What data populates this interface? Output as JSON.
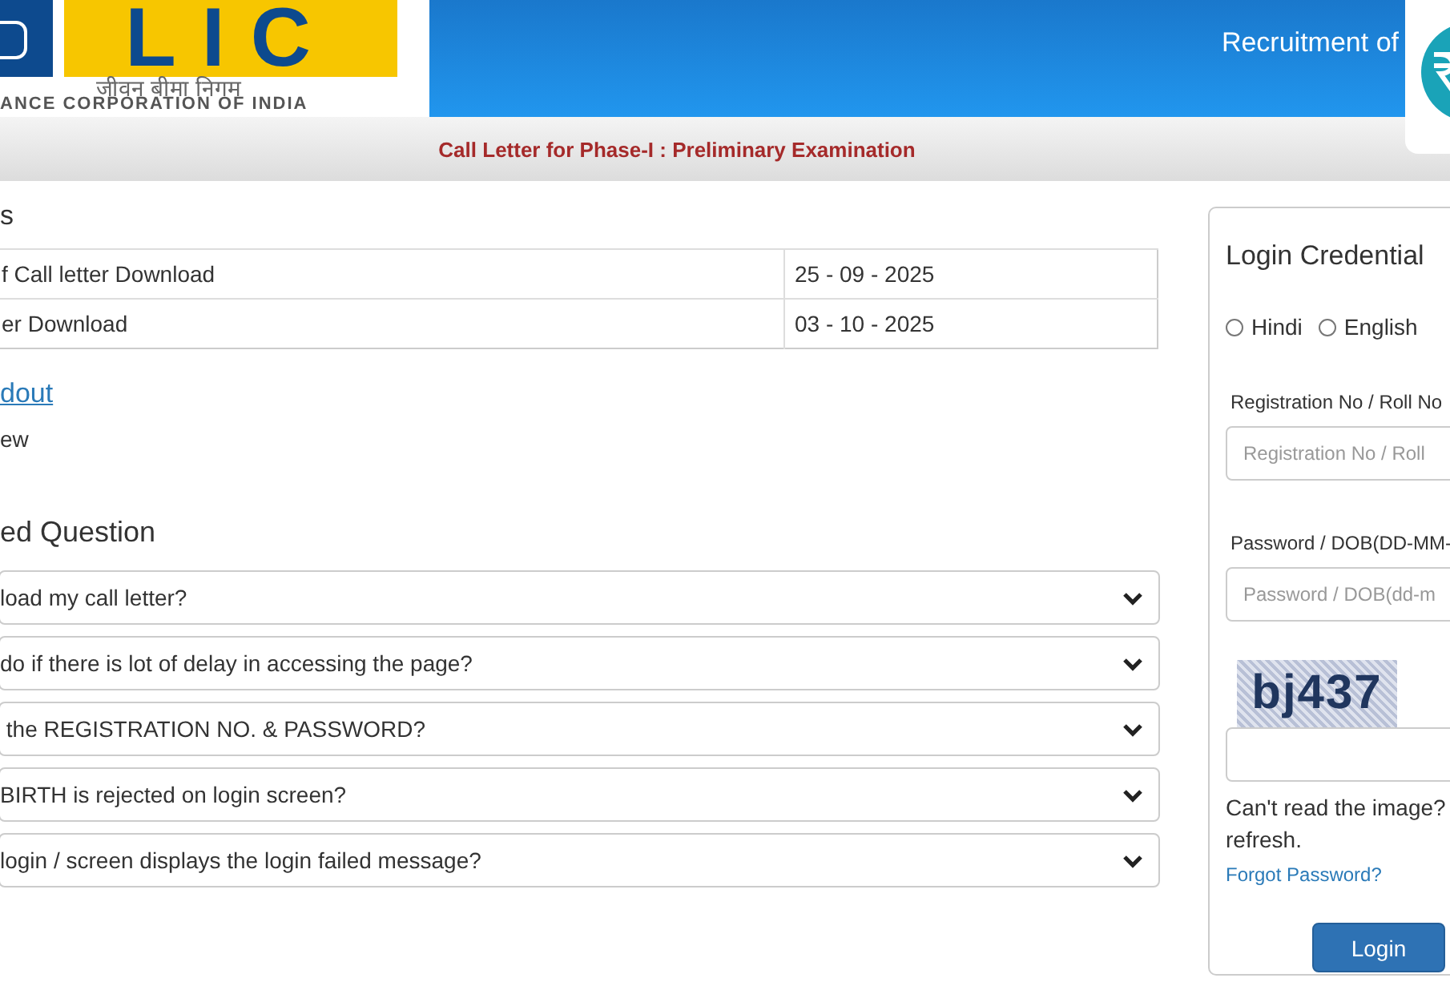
{
  "header": {
    "logo": {
      "mark": "LIC",
      "hindi": "जीवन बीमा निगम",
      "english": "ANCE CORPORATION OF INDIA"
    },
    "title": "Recruitment of"
  },
  "subheader": "Call Letter for Phase-I : Preliminary Examination",
  "dates": {
    "heading": "s",
    "rows": [
      {
        "label": "f Call letter Download",
        "value": "25 - 09 - 2025"
      },
      {
        "label": "er Download",
        "value": "03 - 10 - 2025"
      }
    ]
  },
  "links": [
    {
      "kind": "link",
      "text": "dout"
    },
    {
      "kind": "text",
      "text": "ew"
    }
  ],
  "faq": {
    "heading": "ed Question",
    "items": [
      {
        "question": "load my call letter?",
        "expanded": false
      },
      {
        "question": "do if there is lot of delay in accessing the page?",
        "expanded": false
      },
      {
        "question": " the REGISTRATION NO. & PASSWORD?",
        "expanded": false
      },
      {
        "question": "BIRTH is rejected on login screen?",
        "expanded": false
      },
      {
        "question": "login / screen displays the login failed message?",
        "expanded": false
      }
    ]
  },
  "login": {
    "title": "Login Credential",
    "languages": [
      {
        "label": "Hindi",
        "selected": false
      },
      {
        "label": "English",
        "selected": false
      }
    ],
    "fields": [
      {
        "label": "Registration No / Roll No",
        "placeholder": "Registration No / Roll"
      },
      {
        "label": "Password / DOB(DD-MM-",
        "placeholder": "Password / DOB(dd-m"
      }
    ],
    "captcha": "bj437",
    "help": [
      "Can't read the image?",
      "refresh."
    ],
    "forgot": "Forgot Password?",
    "button": "Login"
  }
}
